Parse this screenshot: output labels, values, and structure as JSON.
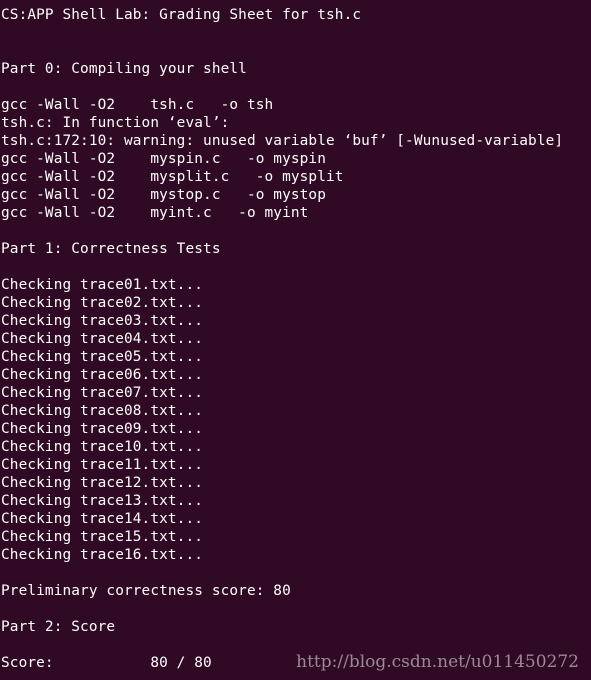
{
  "terminal": {
    "header": "CS:APP Shell Lab: Grading Sheet for tsh.c",
    "part0": "Part 0: Compiling your shell",
    "compile": [
      "gcc -Wall -O2    tsh.c   -o tsh",
      "tsh.c: In function ‘eval’:",
      "tsh.c:172:10: warning: unused variable ‘buf’ [-Wunused-variable]",
      "gcc -Wall -O2    myspin.c   -o myspin",
      "gcc -Wall -O2    mysplit.c   -o mysplit",
      "gcc -Wall -O2    mystop.c   -o mystop",
      "gcc -Wall -O2    myint.c   -o myint"
    ],
    "part1": "Part 1: Correctness Tests",
    "checks": [
      "Checking trace01.txt...",
      "Checking trace02.txt...",
      "Checking trace03.txt...",
      "Checking trace04.txt...",
      "Checking trace05.txt...",
      "Checking trace06.txt...",
      "Checking trace07.txt...",
      "Checking trace08.txt...",
      "Checking trace09.txt...",
      "Checking trace10.txt...",
      "Checking trace11.txt...",
      "Checking trace12.txt...",
      "Checking trace13.txt...",
      "Checking trace14.txt...",
      "Checking trace15.txt...",
      "Checking trace16.txt..."
    ],
    "prelim": "Preliminary correctness score: 80",
    "part2": "Part 2: Score",
    "score": "Score:           80 / 80"
  },
  "watermark": "http://blog.csdn.net/u011450272",
  "colors": {
    "background": "#300a24",
    "text": "#ffffff",
    "watermark": "#9b8a95"
  }
}
